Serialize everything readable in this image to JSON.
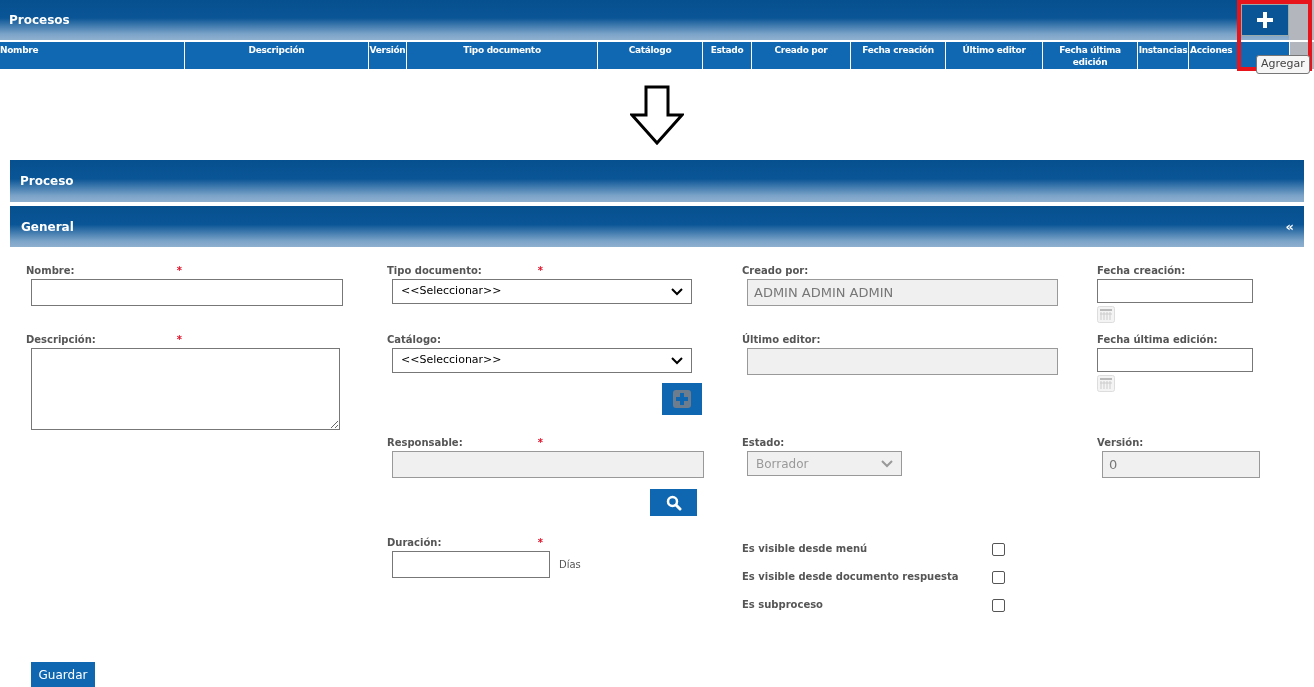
{
  "list_panel": {
    "title": "Procesos",
    "add_tooltip": "Agregar",
    "columns": [
      "Nombre",
      "Descripción",
      "Versión",
      "Tipo documento",
      "Catálogo",
      "Estado",
      "Creado por",
      "Fecha creación",
      "Último editor",
      "Fecha última edición",
      "Instancias",
      "Acciones"
    ]
  },
  "form_panel": {
    "title": "Proceso",
    "section": {
      "title": "General",
      "collapse_glyph": "«",
      "expanded": true
    },
    "columns": [
      [
        {
          "kind": "text",
          "label": "Nombre:",
          "required_mark": "*"
        },
        {
          "kind": "textarea",
          "label": "Descripción:",
          "required_mark": "*"
        }
      ],
      [
        {
          "kind": "select",
          "label": "Tipo documento:",
          "required_mark": "*",
          "value": "<<Seleccionar>>",
          "disabled": false
        },
        {
          "kind": "select",
          "label": "Catálogo:",
          "value": "<<Seleccionar>>",
          "disabled": false,
          "add_button": true
        },
        {
          "kind": "text",
          "label": "Responsable:",
          "required_mark": "*",
          "disabled": true,
          "search_button": true
        },
        {
          "kind": "duration",
          "label": "Duración:",
          "required_mark": "*",
          "unit": "Días"
        }
      ],
      [
        {
          "kind": "text",
          "label": "Creado por:",
          "value": "ADMIN ADMIN ADMIN",
          "disabled": true
        },
        {
          "kind": "text",
          "label": "Último editor:",
          "disabled": true
        },
        {
          "kind": "select",
          "label": "Estado:",
          "value": "Borrador",
          "disabled": true
        },
        {
          "kind": "checks",
          "items": [
            {
              "label": "Es visible desde menú",
              "checked": false
            },
            {
              "label": "Es visible desde documento respuesta",
              "checked": false
            },
            {
              "label": "Es subproceso",
              "checked": false
            }
          ]
        }
      ],
      [
        {
          "kind": "date",
          "label": "Fecha creación:"
        },
        {
          "kind": "date",
          "label": "Fecha última edición:"
        },
        {
          "kind": "text",
          "label": "Versión:",
          "value": "0",
          "disabled": true
        }
      ]
    ],
    "save_button": "Guardar"
  }
}
